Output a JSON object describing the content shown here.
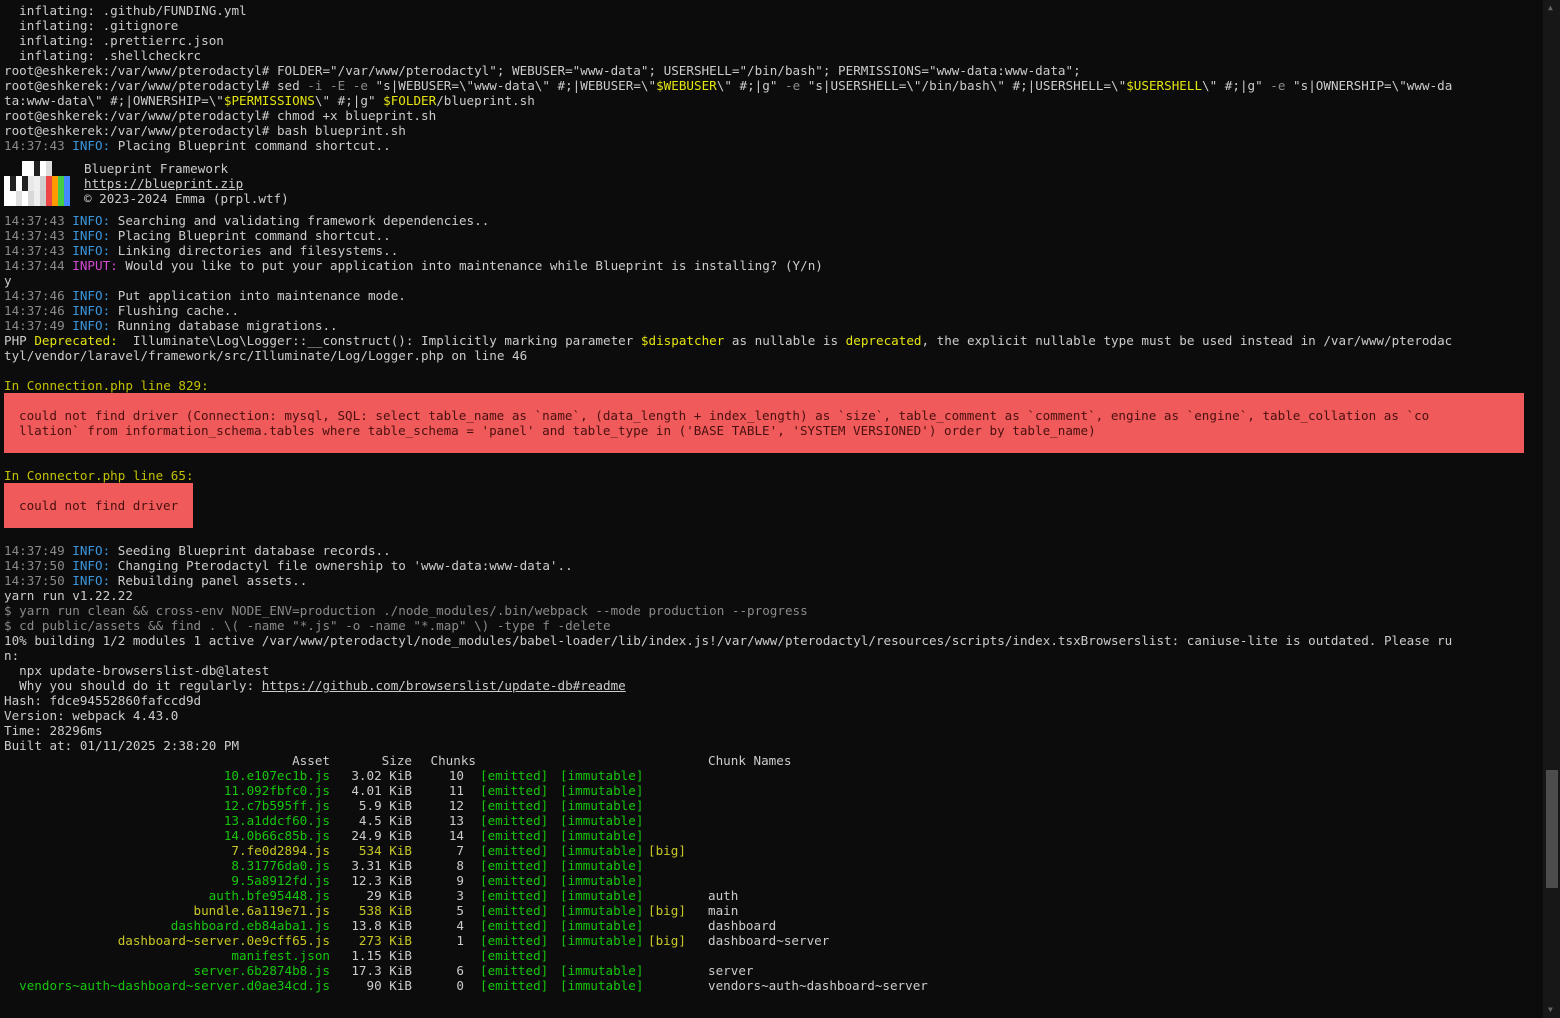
{
  "terminal": {
    "inflating": [
      "  inflating: .github/FUNDING.yml",
      "  inflating: .gitignore",
      "  inflating: .prettierrc.json",
      "  inflating: .shellcheckrc"
    ],
    "cmd_folder": "root@eshkerek:/var/www/pterodactyl# FOLDER=\"/var/www/pterodactyl\"; WEBUSER=\"www-data\"; USERSHELL=\"/bin/bash\"; PERMISSIONS=\"www-data:www-data\";",
    "cmd_sed": {
      "prompt": "root@eshkerek:/var/www/pterodactyl# sed ",
      "f1": "-i -E -e",
      "s1": " \"s|WEBUSER=\\\"www-data\\\" #;|WEBUSER=\\\"",
      "v1": "$WEBUSER",
      "s2": "\\\" #;|g\" ",
      "f2": "-e",
      "s3": " \"s|USERSHELL=\\\"/bin/bash\\\" #;|USERSHELL=\\\"",
      "v2": "$USERSHELL",
      "s4": "\\\" #;|g\" ",
      "f3": "-e",
      "s5": " \"s|OWNERSHIP=\\\"www-da",
      "line2a": "ta:www-data\\\" #;|OWNERSHIP=\\\"",
      "v3": "$PERMISSIONS",
      "line2b": "\\\" #;|g\" ",
      "v4": "$FOLDER",
      "line2c": "/blueprint.sh"
    },
    "cmd_chmod": "root@eshkerek:/var/www/pterodactyl# chmod +x blueprint.sh",
    "cmd_bash": "root@eshkerek:/var/www/pterodactyl# bash blueprint.sh",
    "log1": {
      "time": "14:37:43 ",
      "level": "INFO:",
      "msg": " Placing Blueprint command shortcut.."
    },
    "banner": {
      "name": "Blueprint Framework",
      "url": "https://blueprint.zip",
      "copyright": "© 2023-2024 Emma (prpl.wtf)"
    },
    "logs": [
      {
        "time": "14:37:43 ",
        "level": "INFO:",
        "msg": " Searching and validating framework dependencies.."
      },
      {
        "time": "14:37:43 ",
        "level": "INFO:",
        "msg": " Placing Blueprint command shortcut.."
      },
      {
        "time": "14:37:43 ",
        "level": "INFO:",
        "msg": " Linking directories and filesystems.."
      }
    ],
    "input_log": {
      "time": "14:37:44 ",
      "level": "INPUT:",
      "msg": " Would you like to put your application into maintenance while Blueprint is installing? (Y/n)"
    },
    "answer": "y",
    "logs2": [
      {
        "time": "14:37:46 ",
        "level": "INFO:",
        "msg": " Put application into maintenance mode."
      },
      {
        "time": "14:37:46 ",
        "level": "INFO:",
        "msg": " Flushing cache.."
      },
      {
        "time": "14:37:49 ",
        "level": "INFO:",
        "msg": " Running database migrations.."
      }
    ],
    "deprecation": {
      "p1": "PHP ",
      "p2": "Deprecated:",
      "p3": "  Illuminate\\Log\\Logger::__construct(): Implicitly marking parameter ",
      "p4": "$dispatcher",
      "p5": " as nullable is ",
      "p6": "deprecated",
      "p7": ", the explicit nullable type must be used instead in /var/www/pterodac",
      "p8": "tyl/vendor/laravel/framework/src/Illuminate/Log/Logger.php on line 46"
    },
    "error1": {
      "title": "In Connection.php line 829:",
      "line1": "could not find driver (Connection: mysql, SQL: select table_name as `name`, (data_length + index_length) as `size`, table_comment as `comment`, engine as `engine`, table_collation as `co",
      "line2": "llation` from information_schema.tables where table_schema = 'panel' and table_type in ('BASE TABLE', 'SYSTEM VERSIONED') order by table_name)"
    },
    "error2": {
      "title": "In Connector.php line 65:",
      "line1": "could not find driver"
    },
    "logs3": [
      {
        "time": "14:37:49 ",
        "level": "INFO:",
        "msg": " Seeding Blueprint database records.."
      },
      {
        "time": "14:37:50 ",
        "level": "INFO:",
        "msg": " Changing Pterodactyl file ownership to 'www-data:www-data'.."
      },
      {
        "time": "14:37:50 ",
        "level": "INFO:",
        "msg": " Rebuilding panel assets.."
      }
    ],
    "yarn": "yarn run v1.22.22",
    "cmd1": "$ yarn run clean && cross-env NODE_ENV=production ./node_modules/.bin/webpack --mode production --progress",
    "cmd2": "$ cd public/assets && find . \\( -name \"*.js\" -o -name \"*.map\" \\) -type f -delete",
    "progress1": "10% building 1/2 modules 1 active /var/www/pterodactyl/node_modules/babel-loader/lib/index.js!/var/www/pterodactyl/resources/scripts/index.tsxBrowserslist: caniuse-lite is outdated. Please ru",
    "progress2": "n:",
    "npx": "  npx update-browserslist-db@latest",
    "why": "  Why you should do it regularly: ",
    "why_link": "https://github.com/browserslist/update-db#readme",
    "hash": "Hash: fdce94552860fafccd9d",
    "version": "Version: webpack 4.43.0",
    "time": "Time: 28296ms",
    "built": "Built at: 01/11/2025 2:38:20 PM",
    "table_headers": {
      "asset": "Asset",
      "size": "Size",
      "chunks": "Chunks",
      "chunk_names": "Chunk Names"
    },
    "assets": [
      {
        "asset": "10.e107ec1b.js",
        "size": "3.02 KiB",
        "chunks": "10",
        "emitted": "[emitted]",
        "immutable": "[immutable]",
        "big": "",
        "names": "",
        "color": "grn"
      },
      {
        "asset": "11.092fbfc0.js",
        "size": "4.01 KiB",
        "chunks": "11",
        "emitted": "[emitted]",
        "immutable": "[immutable]",
        "big": "",
        "names": "",
        "color": "grn"
      },
      {
        "asset": "12.c7b595ff.js",
        "size": "5.9 KiB",
        "chunks": "12",
        "emitted": "[emitted]",
        "immutable": "[immutable]",
        "big": "",
        "names": "",
        "color": "grn"
      },
      {
        "asset": "13.a1ddcf60.js",
        "size": "4.5 KiB",
        "chunks": "13",
        "emitted": "[emitted]",
        "immutable": "[immutable]",
        "big": "",
        "names": "",
        "color": "grn"
      },
      {
        "asset": "14.0b66c85b.js",
        "size": "24.9 KiB",
        "chunks": "14",
        "emitted": "[emitted]",
        "immutable": "[immutable]",
        "big": "",
        "names": "",
        "color": "grn"
      },
      {
        "asset": "7.fe0d2894.js",
        "size": "534 KiB",
        "chunks": "7",
        "emitted": "[emitted]",
        "immutable": "[immutable]",
        "big": "[big]",
        "names": "",
        "color": "yel"
      },
      {
        "asset": "8.31776da0.js",
        "size": "3.31 KiB",
        "chunks": "8",
        "emitted": "[emitted]",
        "immutable": "[immutable]",
        "big": "",
        "names": "",
        "color": "grn"
      },
      {
        "asset": "9.5a8912fd.js",
        "size": "12.3 KiB",
        "chunks": "9",
        "emitted": "[emitted]",
        "immutable": "[immutable]",
        "big": "",
        "names": "",
        "color": "grn"
      },
      {
        "asset": "auth.bfe95448.js",
        "size": "29 KiB",
        "chunks": "3",
        "emitted": "[emitted]",
        "immutable": "[immutable]",
        "big": "",
        "names": "auth",
        "color": "grn"
      },
      {
        "asset": "bundle.6a119e71.js",
        "size": "538 KiB",
        "chunks": "5",
        "emitted": "[emitted]",
        "immutable": "[immutable]",
        "big": "[big]",
        "names": "main",
        "color": "yel"
      },
      {
        "asset": "dashboard.eb84aba1.js",
        "size": "13.8 KiB",
        "chunks": "4",
        "emitted": "[emitted]",
        "immutable": "[immutable]",
        "big": "",
        "names": "dashboard",
        "color": "grn"
      },
      {
        "asset": "dashboard~server.0e9cff65.js",
        "size": "273 KiB",
        "chunks": "1",
        "emitted": "[emitted]",
        "immutable": "[immutable]",
        "big": "[big]",
        "names": "dashboard~server",
        "color": "yel"
      },
      {
        "asset": "manifest.json",
        "size": "1.15 KiB",
        "chunks": "",
        "emitted": "[emitted]",
        "immutable": "",
        "big": "",
        "names": "",
        "color": "grn"
      },
      {
        "asset": "server.6b2874b8.js",
        "size": "17.3 KiB",
        "chunks": "6",
        "emitted": "[emitted]",
        "immutable": "[immutable]",
        "big": "",
        "names": "server",
        "color": "grn"
      },
      {
        "asset": "vendors~auth~dashboard~server.d0ae34cd.js",
        "size": "90 KiB",
        "chunks": "0",
        "emitted": "[emitted]",
        "immutable": "[immutable]",
        "big": "",
        "names": "vendors~auth~dashboard~server",
        "color": "grn"
      }
    ],
    "colors": {
      "background": "#0c0c0c",
      "text": "#cccccc",
      "info": "#3a96dd",
      "input": "#d449d4",
      "error_bg": "#f05a5a",
      "warn": "#e5e510",
      "asset_green": "#16c60c",
      "asset_yellow": "#c8c826"
    }
  }
}
